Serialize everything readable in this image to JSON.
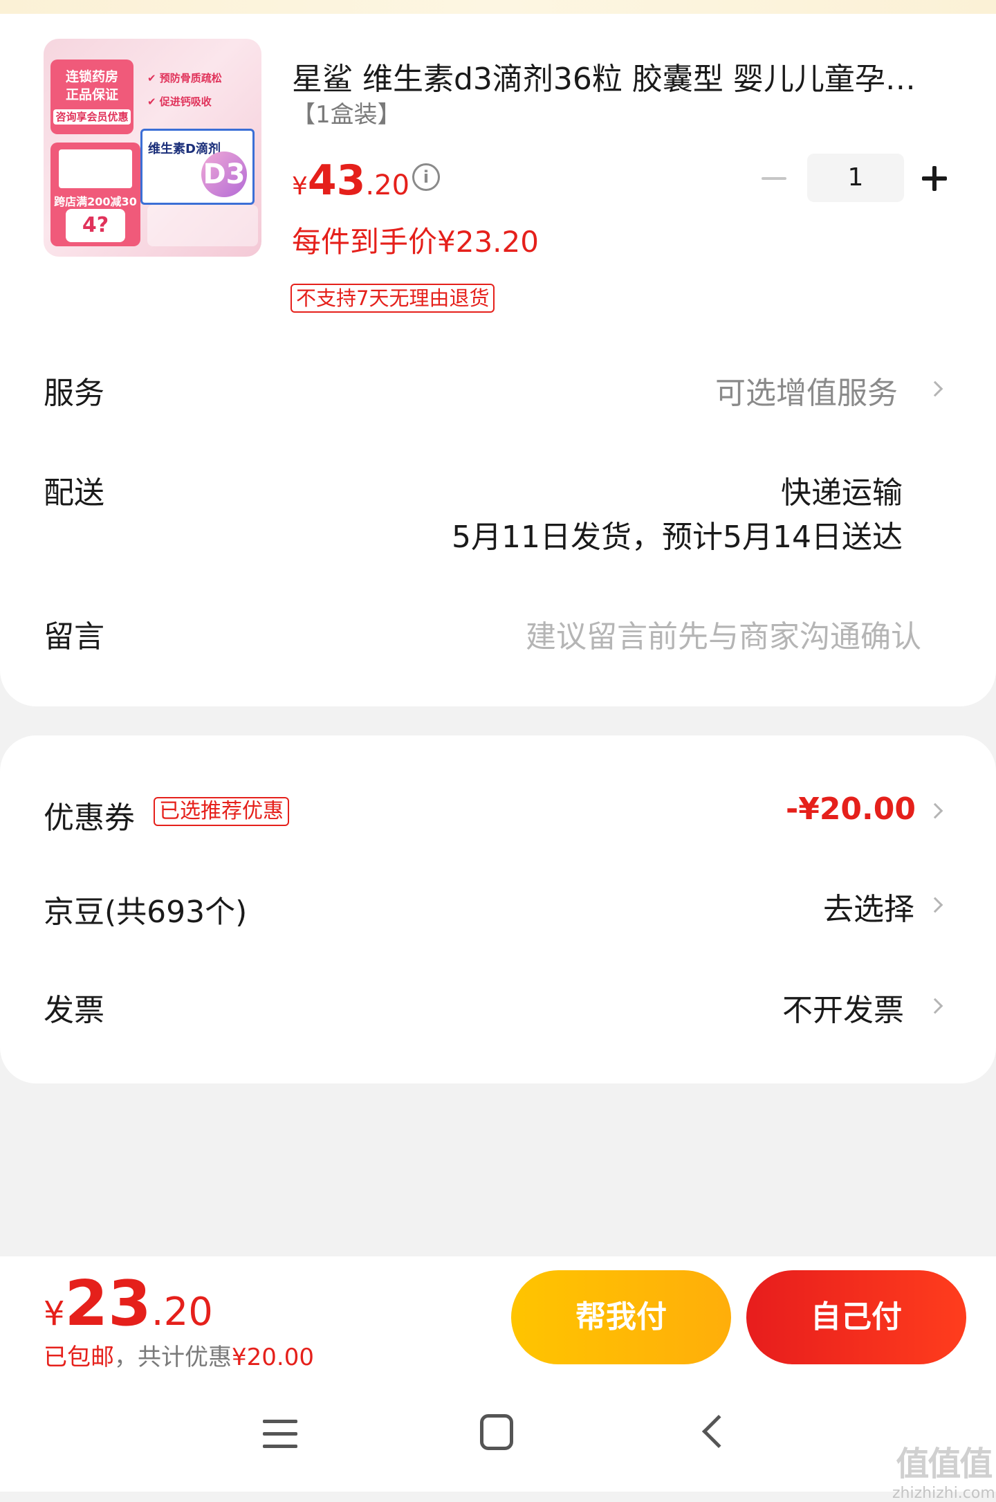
{
  "product": {
    "title": "星鲨 维生素d3滴剂36粒 胶囊型 婴儿儿童孕…",
    "spec": "【1盒装】",
    "price_yen": "¥",
    "price_int": "43",
    "price_dec": ".20",
    "info_icon": "i",
    "quantity": "1",
    "unit_price": "每件到手价¥23.20",
    "no_return": "不支持7天无理由退货",
    "image": {
      "tag_line1": "连锁药房",
      "tag_line2": "正品保证",
      "tag_line3": "咨询享会员优惠",
      "bullet1": "✔ 预防骨质疏松",
      "bullet2": "✔ 促进钙吸收",
      "promo": "跨店满200减30",
      "price_badge": "4?",
      "product_name": "维生素D滴剂",
      "d3": "D3"
    }
  },
  "rows": {
    "service": {
      "label": "服务",
      "value": "可选增值服务"
    },
    "delivery": {
      "label": "配送",
      "method": "快递运输",
      "schedule": "5月11日发货，预计5月14日送达"
    },
    "message": {
      "label": "留言",
      "placeholder": "建议留言前先与商家沟通确认"
    }
  },
  "discounts": {
    "coupon": {
      "label": "优惠券",
      "badge": "已选推荐优惠",
      "value": "-¥20.00"
    },
    "jingdou": {
      "label": "京豆(共693个)",
      "value": "去选择"
    },
    "invoice": {
      "label": "发票",
      "value": "不开发票"
    }
  },
  "footer": {
    "total_yen": "¥",
    "total_int": "23",
    "total_dec": ".20",
    "shipping": "已包邮",
    "sep": "，共计优惠",
    "saved": "¥20.00",
    "help_pay": "帮我付",
    "self_pay": "自己付"
  },
  "watermark": {
    "logo": "值值值",
    "site": "zhizhizhi.com"
  },
  "colors": {
    "accent_red": "#e5201b",
    "help_yellow": "#ffb800",
    "self_red": "#f02a1b"
  }
}
